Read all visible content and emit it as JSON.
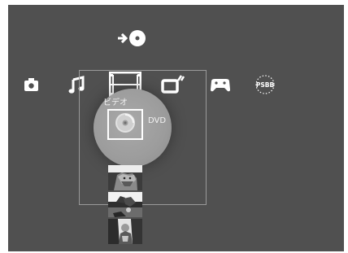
{
  "top_item": {
    "icon": "disc-insert-icon"
  },
  "xmb": {
    "items": [
      {
        "name": "photo",
        "icon": "camera-icon"
      },
      {
        "name": "music",
        "icon": "music-note-icon"
      },
      {
        "name": "video",
        "icon": "film-strip-icon"
      },
      {
        "name": "tv",
        "icon": "tv-icon"
      },
      {
        "name": "game",
        "icon": "gamepad-icon"
      },
      {
        "name": "network",
        "icon": "psbb-icon",
        "label": "PSBB"
      }
    ]
  },
  "focus": {
    "category_label": "ビデオ",
    "item_label": "DVD",
    "item_icon": "dvd-disc-icon"
  },
  "thumbnails": [
    {
      "icon": "video-thumbnail-1"
    },
    {
      "icon": "video-thumbnail-2"
    },
    {
      "icon": "video-thumbnail-3"
    }
  ],
  "colors": {
    "background": "#505050",
    "icon": "#ffffff"
  }
}
